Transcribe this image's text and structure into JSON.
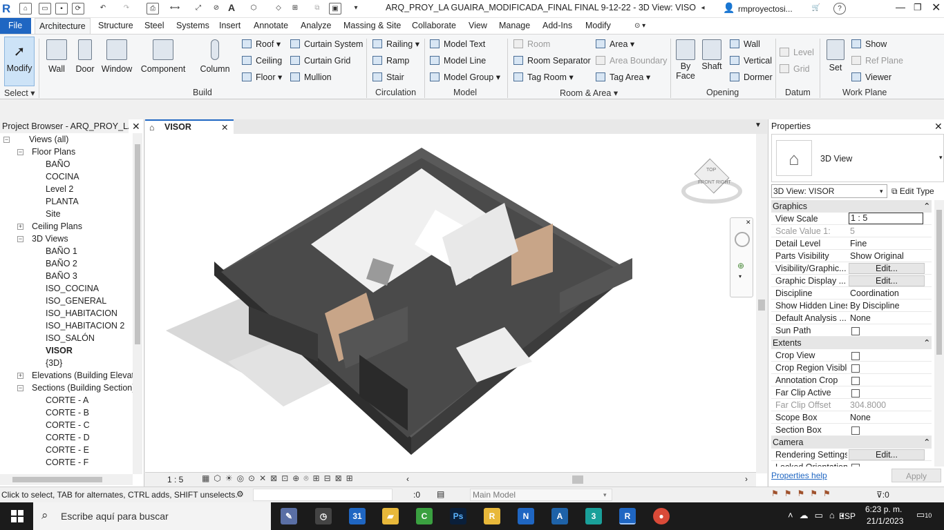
{
  "title": "ARQ_PROY_LA GUAIRA_MODIFICADA_FINAL FINAL  9-12-22 - 3D View: VISOR",
  "user": "rmproyectosi...",
  "tabs": [
    "File",
    "Architecture",
    "Structure",
    "Steel",
    "Systems",
    "Insert",
    "Annotate",
    "Analyze",
    "Massing & Site",
    "Collaborate",
    "View",
    "Manage",
    "Add-Ins",
    "Modify"
  ],
  "ribbon": {
    "modify": "Modify",
    "select": "Select",
    "build": {
      "wall": "Wall",
      "door": "Door",
      "window": "Window",
      "component": "Component",
      "column": "Column",
      "roof": "Roof",
      "ceiling": "Ceiling",
      "floor": "Floor",
      "curtain_system": "Curtain System",
      "curtain_grid": "Curtain Grid",
      "mullion": "Mullion",
      "label": "Build"
    },
    "circulation": {
      "railing": "Railing",
      "ramp": "Ramp",
      "stair": "Stair",
      "label": "Circulation"
    },
    "model": {
      "text": "Model Text",
      "line": "Model Line",
      "group": "Model Group",
      "label": "Model"
    },
    "room_area": {
      "room": "Room",
      "room_separator": "Room Separator",
      "tag_room": "Tag Room",
      "area": "Area",
      "area_boundary": "Area Boundary",
      "tag_area": "Tag Area",
      "label": "Room & Area"
    },
    "opening": {
      "by_face": "By\nFace",
      "shaft": "Shaft",
      "wall": "Wall",
      "vertical": "Vertical",
      "dormer": "Dormer",
      "label": "Opening"
    },
    "datum": {
      "level": "Level",
      "grid": "Grid",
      "label": "Datum"
    },
    "work_plane": {
      "set": "Set",
      "show": "Show",
      "ref_plane": "Ref Plane",
      "viewer": "Viewer",
      "label": "Work Plane"
    }
  },
  "project_browser": {
    "title": "Project Browser - ARQ_PROY_LA...",
    "rows": [
      {
        "label": "Views (all)",
        "indent": 0,
        "toggle": "-"
      },
      {
        "label": "Floor Plans",
        "indent": 1,
        "toggle": "-"
      },
      {
        "label": "BAÑO",
        "indent": 2
      },
      {
        "label": "COCINA",
        "indent": 2
      },
      {
        "label": "Level 2",
        "indent": 2
      },
      {
        "label": "PLANTA",
        "indent": 2
      },
      {
        "label": "Site",
        "indent": 2
      },
      {
        "label": "Ceiling Plans",
        "indent": 1,
        "toggle": "+"
      },
      {
        "label": "3D Views",
        "indent": 1,
        "toggle": "-"
      },
      {
        "label": "BAÑO 1",
        "indent": 2
      },
      {
        "label": "BAÑO 2",
        "indent": 2
      },
      {
        "label": "BAÑO 3",
        "indent": 2
      },
      {
        "label": "ISO_COCINA",
        "indent": 2
      },
      {
        "label": "ISO_GENERAL",
        "indent": 2
      },
      {
        "label": "ISO_HABITACION",
        "indent": 2
      },
      {
        "label": "ISO_HABITACION 2",
        "indent": 2
      },
      {
        "label": "ISO_SALÓN",
        "indent": 2
      },
      {
        "label": "VISOR",
        "indent": 2,
        "bold": true
      },
      {
        "label": "{3D}",
        "indent": 2
      },
      {
        "label": "Elevations (Building Elevati",
        "indent": 1,
        "toggle": "+"
      },
      {
        "label": "Sections (Building Section)",
        "indent": 1,
        "toggle": "-"
      },
      {
        "label": "CORTE - A",
        "indent": 2
      },
      {
        "label": "CORTE - B",
        "indent": 2
      },
      {
        "label": "CORTE - C",
        "indent": 2
      },
      {
        "label": "CORTE - D",
        "indent": 2
      },
      {
        "label": "CORTE - E",
        "indent": 2
      },
      {
        "label": "CORTE - F",
        "indent": 2
      }
    ]
  },
  "view": {
    "tab": "VISOR",
    "scale": "1 : 5",
    "viewcube_top": "TOP",
    "viewcube_front": "FRONT",
    "viewcube_right": "RIGHT"
  },
  "properties": {
    "title": "Properties",
    "type": "3D View",
    "selector": "3D View: VISOR",
    "edit_type": "Edit Type",
    "groups": [
      {
        "name": "Graphics",
        "rows": [
          {
            "k": "View Scale",
            "v": "1 : 5",
            "kind": "input"
          },
          {
            "k": "Scale Value    1:",
            "v": "5",
            "kind": "dis"
          },
          {
            "k": "Detail Level",
            "v": "Fine"
          },
          {
            "k": "Parts Visibility",
            "v": "Show Original"
          },
          {
            "k": "Visibility/Graphic...",
            "v": "Edit...",
            "kind": "btn"
          },
          {
            "k": "Graphic Display ...",
            "v": "Edit...",
            "kind": "btn"
          },
          {
            "k": "Discipline",
            "v": "Coordination"
          },
          {
            "k": "Show Hidden Lines",
            "v": "By Discipline"
          },
          {
            "k": "Default Analysis ...",
            "v": "None"
          },
          {
            "k": "Sun Path",
            "v": "",
            "kind": "cb"
          }
        ]
      },
      {
        "name": "Extents",
        "rows": [
          {
            "k": "Crop View",
            "v": "",
            "kind": "cb"
          },
          {
            "k": "Crop Region Visible",
            "v": "",
            "kind": "cb"
          },
          {
            "k": "Annotation Crop",
            "v": "",
            "kind": "cb"
          },
          {
            "k": "Far Clip Active",
            "v": "",
            "kind": "cb"
          },
          {
            "k": "Far Clip Offset",
            "v": "304.8000",
            "kind": "dis"
          },
          {
            "k": "Scope Box",
            "v": "None"
          },
          {
            "k": "Section Box",
            "v": "",
            "kind": "cb"
          }
        ]
      },
      {
        "name": "Camera",
        "rows": [
          {
            "k": "Rendering Settings",
            "v": "Edit...",
            "kind": "btn"
          },
          {
            "k": "Locked Orientation",
            "v": "",
            "kind": "cb"
          }
        ]
      }
    ],
    "help": "Properties help",
    "apply": "Apply"
  },
  "status": {
    "hint": "Click to select, TAB for alternates, CTRL adds, SHIFT unselects.",
    "count": ":0",
    "model": "Main Model",
    "filter": ":0"
  },
  "taskbar": {
    "search": "Escribe aquí para buscar",
    "lang": "ESP",
    "time": "6:23 p. m.",
    "date": "21/1/2023",
    "notif": "10"
  }
}
